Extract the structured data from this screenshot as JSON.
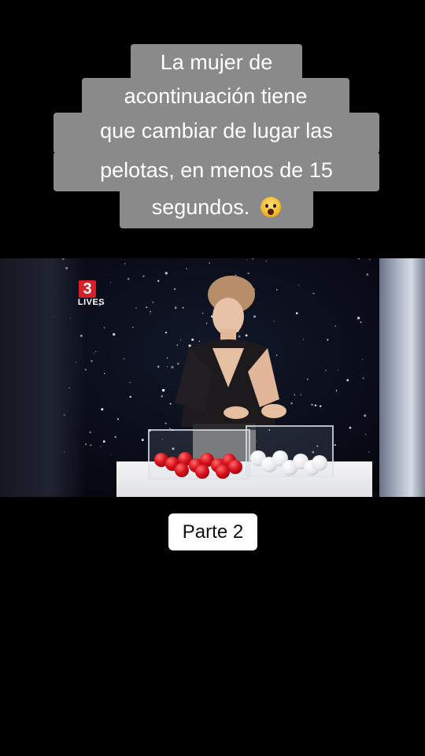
{
  "caption": {
    "lines": [
      "La mujer de",
      "acontinuación tiene",
      "que cambiar de lugar las",
      "pelotas, en menos de 15",
      "segundos."
    ],
    "emoji": "face-screaming-in-fear-icon"
  },
  "video": {
    "logo_number": "3",
    "logo_text": "LIVES"
  },
  "badge": {
    "label": "Parte 2"
  }
}
